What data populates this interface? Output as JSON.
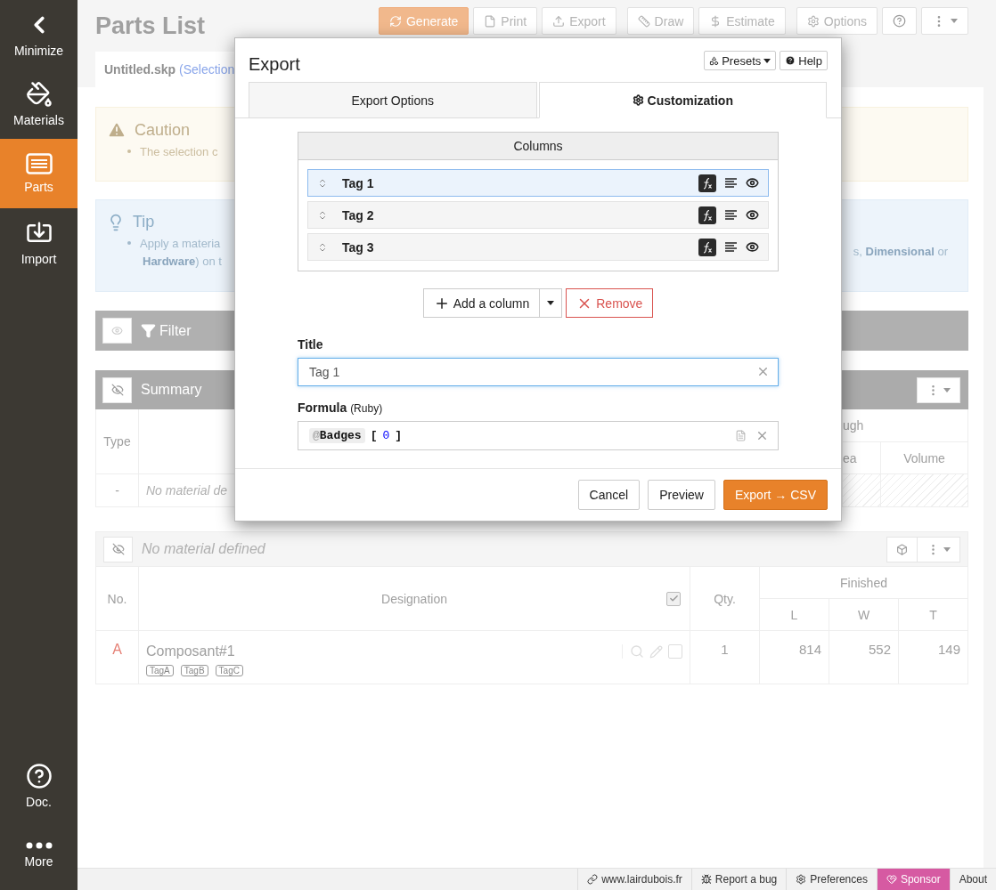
{
  "sidebar": {
    "items": [
      {
        "label": "Minimize",
        "kind": "chevron",
        "selected": false
      },
      {
        "label": "Materials",
        "kind": "bucket",
        "selected": false
      },
      {
        "label": "Parts",
        "kind": "parts",
        "selected": true
      },
      {
        "label": "Import",
        "kind": "import",
        "selected": false
      }
    ],
    "bottom_items": [
      {
        "label": "Doc.",
        "kind": "help"
      },
      {
        "label": "More",
        "kind": "more"
      }
    ]
  },
  "header": {
    "title": "Parts List",
    "toolbar": [
      {
        "label": "Generate",
        "kind": "generate"
      },
      {
        "label": "Print",
        "kind": "print"
      },
      {
        "label": "Export",
        "kind": "export"
      },
      {
        "label": "Draw",
        "kind": "draw"
      },
      {
        "label": "Estimate",
        "kind": "estimate"
      },
      {
        "label": "Options",
        "kind": "options"
      }
    ]
  },
  "file_tab": {
    "name": "Untitled.skp",
    "selection": "(Selection"
  },
  "caution": {
    "title": "Caution",
    "text": "The selection c"
  },
  "tip": {
    "title": "Tip",
    "lines_left": [
      "Apply a materia",
      "**Hardware**) on t"
    ],
    "line_right": "s, **Dimensional** or"
  },
  "filter": {
    "label": "Filter"
  },
  "summary": {
    "title": "Summary",
    "type_header": "Type",
    "header_right": "ugh",
    "subheaders_right": [
      "ea",
      "Volume"
    ],
    "row": {
      "type": "-",
      "text": "No material de"
    }
  },
  "group": {
    "title": "No material defined",
    "columns": [
      "No.",
      "Designation",
      "Qty."
    ],
    "select_all_checked": true,
    "finished": {
      "label": "Finished",
      "columns": [
        "L",
        "W",
        "T"
      ]
    },
    "rows": [
      {
        "number": "A",
        "name": "Composant#1",
        "tags": [
          "TagA",
          "TagB",
          "TagC"
        ],
        "checked": false,
        "qty": "1",
        "values": [
          "814",
          "552",
          "149"
        ]
      }
    ]
  },
  "status_bar": [
    {
      "label": "www.lairdubois.fr",
      "kind": "link"
    },
    {
      "label": "Report a bug",
      "kind": "bug"
    },
    {
      "label": "Preferences",
      "kind": "gear"
    },
    {
      "label": "Sponsor",
      "kind": "sponsor"
    },
    {
      "label": "About",
      "kind": "plain"
    }
  ],
  "dialog": {
    "title": "Export",
    "header_buttons": [
      {
        "label": "Presets",
        "kind": "presets"
      },
      {
        "label": "Help",
        "kind": "help"
      }
    ],
    "tabs": [
      {
        "label": "Export Options",
        "kind": "plain",
        "selected": false
      },
      {
        "label": "Customization",
        "kind": "gear",
        "selected": true
      }
    ],
    "columns_title": "Columns",
    "columns": [
      {
        "label": "Tag 1",
        "selected": true
      },
      {
        "label": "Tag 2",
        "selected": false
      },
      {
        "label": "Tag 3",
        "selected": false
      }
    ],
    "add_button": "Add a column",
    "remove_button": "Remove",
    "title_field": {
      "label": "Title",
      "value": "Tag 1"
    },
    "formula_field": {
      "label": "Formula",
      "hint": "(Ruby)",
      "prefix": "@",
      "variable": "Badges",
      "tokens": [
        {
          "text": "[",
          "kind": "bracket"
        },
        {
          "text": "0",
          "kind": "number"
        },
        {
          "text": "]",
          "kind": "bracket"
        }
      ]
    },
    "footer_buttons": [
      {
        "label": "Cancel",
        "kind": "default"
      },
      {
        "label": "Preview",
        "kind": "default"
      },
      {
        "label": "Export → CSV",
        "kind": "primary"
      }
    ]
  }
}
